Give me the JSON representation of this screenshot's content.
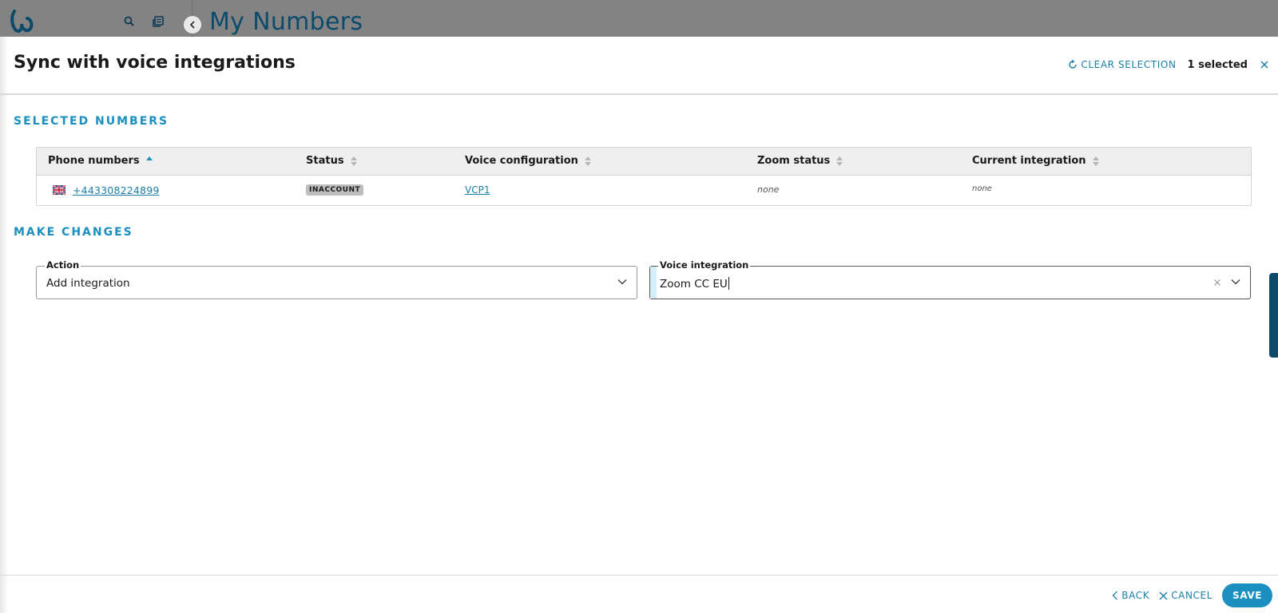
{
  "background": {
    "page_title": "My Numbers"
  },
  "panel": {
    "title": "Sync with voice integrations",
    "clear_selection_label": "CLEAR SELECTION",
    "selected_count_label": "1 selected"
  },
  "selected_numbers": {
    "section_title": "SELECTED NUMBERS",
    "columns": [
      "Phone numbers",
      "Status",
      "Voice configuration",
      "Zoom status",
      "Current integration"
    ],
    "sorted_column": "Phone numbers",
    "sort_direction": "ascending",
    "rows": [
      {
        "country_flag": "uk-flag-icon",
        "phone_number": "+443308224899",
        "status": "INACCOUNT",
        "voice_configuration": "VCP1",
        "zoom_status": "none",
        "current_integration": "none"
      }
    ]
  },
  "make_changes": {
    "section_title": "MAKE CHANGES",
    "action": {
      "label": "Action",
      "value": "Add integration"
    },
    "voice_integration": {
      "label": "Voice integration",
      "value": "Zoom CC EU"
    }
  },
  "footer": {
    "back_label": "BACK",
    "cancel_label": "CANCEL",
    "save_label": "SAVE"
  },
  "colors": {
    "accent": "#1a8fc0",
    "link": "#1a7fa8",
    "brand_dark": "#0b4a6b",
    "overlay_bar": "#838383",
    "badge": "#bdbdbd"
  }
}
